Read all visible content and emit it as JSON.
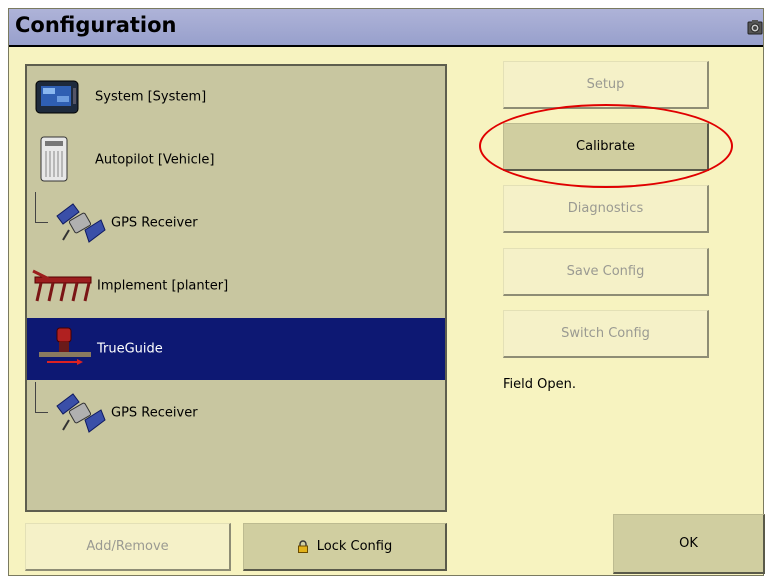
{
  "window": {
    "title": "Configuration",
    "camera_icon": "camera-icon"
  },
  "tree": {
    "items": [
      {
        "label": "System [System]",
        "icon": "display-icon",
        "selected": false
      },
      {
        "label": "Autopilot [Vehicle]",
        "icon": "controller-icon",
        "selected": false
      },
      {
        "label": "GPS Receiver",
        "icon": "satellite-icon",
        "selected": false,
        "child": true
      },
      {
        "label": "Implement [planter]",
        "icon": "planter-icon",
        "selected": false
      },
      {
        "label": "TrueGuide",
        "icon": "trueguide-icon",
        "selected": true
      },
      {
        "label": "GPS Receiver",
        "icon": "satellite-icon",
        "selected": false,
        "child": true
      }
    ]
  },
  "buttons": {
    "setup": {
      "label": "Setup",
      "enabled": false
    },
    "calibrate": {
      "label": "Calibrate",
      "enabled": true
    },
    "diagnostics": {
      "label": "Diagnostics",
      "enabled": false
    },
    "save_config": {
      "label": "Save Config",
      "enabled": false
    },
    "switch_config": {
      "label": "Switch Config",
      "enabled": false
    },
    "add_remove": {
      "label": "Add/Remove",
      "enabled": false
    },
    "lock_config": {
      "label": "Lock Config",
      "icon": "lock-icon",
      "enabled": true
    },
    "ok": {
      "label": "OK",
      "enabled": true
    }
  },
  "status": {
    "text": "Field Open."
  },
  "colors": {
    "selection": "#0d1873",
    "annotation": "#e00000",
    "background": "#f7f3c0"
  }
}
